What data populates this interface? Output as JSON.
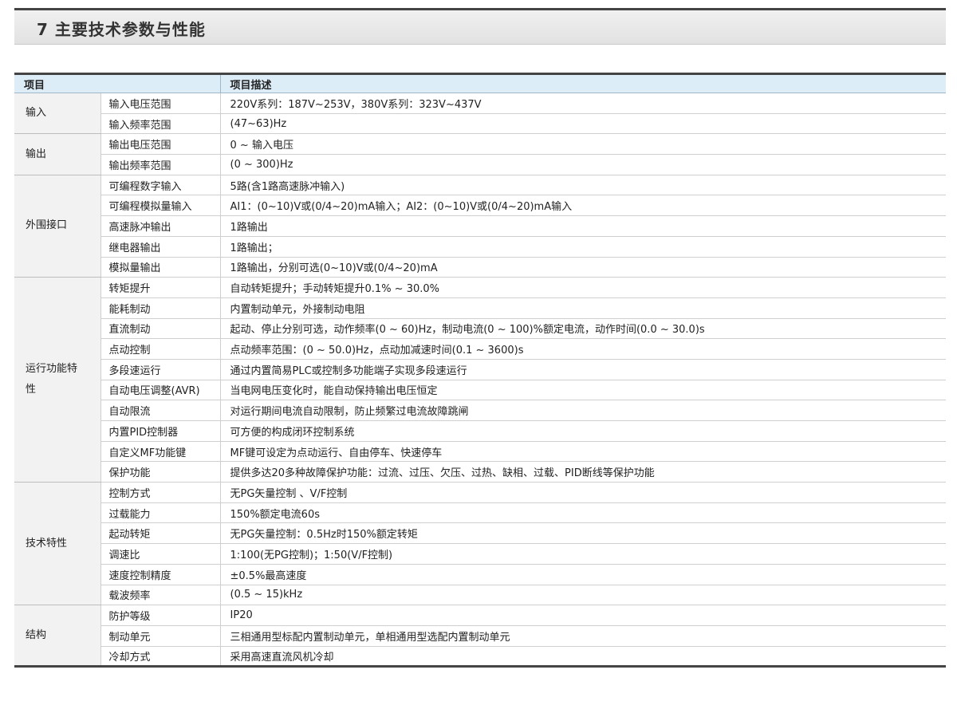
{
  "header": {
    "title": "7 主要技术参数与性能"
  },
  "table": {
    "col_headers": [
      "项目",
      "项目描述"
    ],
    "groups": [
      {
        "category": "输入",
        "rows": [
          {
            "item": "输入电压范围",
            "desc": "220V系列：187V~253V，380V系列：323V~437V"
          },
          {
            "item": "输入频率范围",
            "desc": "(47~63)Hz"
          }
        ]
      },
      {
        "category": "输出",
        "rows": [
          {
            "item": "输出电压范围",
            "desc": "0 ~ 输入电压"
          },
          {
            "item": "输出频率范围",
            "desc": "(0 ~ 300)Hz"
          }
        ]
      },
      {
        "category": "外围接口",
        "rows": [
          {
            "item": "可编程数字输入",
            "desc": "5路(含1路高速脉冲输入)"
          },
          {
            "item": "可编程模拟量输入",
            "desc": "AI1：(0~10)V或(0/4~20)mA输入；AI2：(0~10)V或(0/4~20)mA输入"
          },
          {
            "item": "高速脉冲输出",
            "desc": "1路输出"
          },
          {
            "item": "继电器输出",
            "desc": "1路输出；"
          },
          {
            "item": "模拟量输出",
            "desc": "1路输出，分别可选(0~10)V或(0/4~20)mA"
          }
        ]
      },
      {
        "category": "运行功能特性",
        "rows": [
          {
            "item": "转矩提升",
            "desc": "自动转矩提升；手动转矩提升0.1% ~ 30.0%"
          },
          {
            "item": "能耗制动",
            "desc": "内置制动单元，外接制动电阻"
          },
          {
            "item": "直流制动",
            "desc": "起动、停止分别可选，动作频率(0 ~ 60)Hz，制动电流(0 ~ 100)%额定电流，动作时间(0.0 ~ 30.0)s"
          },
          {
            "item": "点动控制",
            "desc": "点动频率范围：(0 ~ 50.0)Hz，点动加减速时间(0.1 ~ 3600)s"
          },
          {
            "item": "多段速运行",
            "desc": "通过内置简易PLC或控制多功能端子实现多段速运行"
          },
          {
            "item": "自动电压调整(AVR)",
            "desc": "当电网电压变化时，能自动保持输出电压恒定"
          },
          {
            "item": "自动限流",
            "desc": "对运行期间电流自动限制，防止频繁过电流故障跳闸"
          },
          {
            "item": "内置PID控制器",
            "desc": "可方便的构成闭环控制系统"
          },
          {
            "item": "自定义MF功能键",
            "desc": "MF键可设定为点动运行、自由停车、快速停车"
          },
          {
            "item": "保护功能",
            "desc": "提供多达20多种故障保护功能：过流、过压、欠压、过热、缺相、过载、PID断线等保护功能"
          }
        ]
      },
      {
        "category": "技术特性",
        "rows": [
          {
            "item": "控制方式",
            "desc": "无PG矢量控制 、V/F控制"
          },
          {
            "item": "过载能力",
            "desc": "150%额定电流60s"
          },
          {
            "item": "起动转矩",
            "desc": "无PG矢量控制：0.5Hz时150%额定转矩"
          },
          {
            "item": "调速比",
            "desc": "1:100(无PG控制)；1:50(V/F控制)"
          },
          {
            "item": "速度控制精度",
            "desc": "±0.5%最高速度"
          },
          {
            "item": "载波频率",
            "desc": "(0.5 ~ 15)kHz"
          }
        ]
      },
      {
        "category": "结构",
        "rows": [
          {
            "item": "防护等级",
            "desc": "IP20"
          },
          {
            "item": "制动单元",
            "desc": "三相通用型标配内置制动单元，单相通用型选配内置制动单元"
          },
          {
            "item": "冷却方式",
            "desc": "采用高速直流风机冷却"
          }
        ]
      }
    ]
  }
}
